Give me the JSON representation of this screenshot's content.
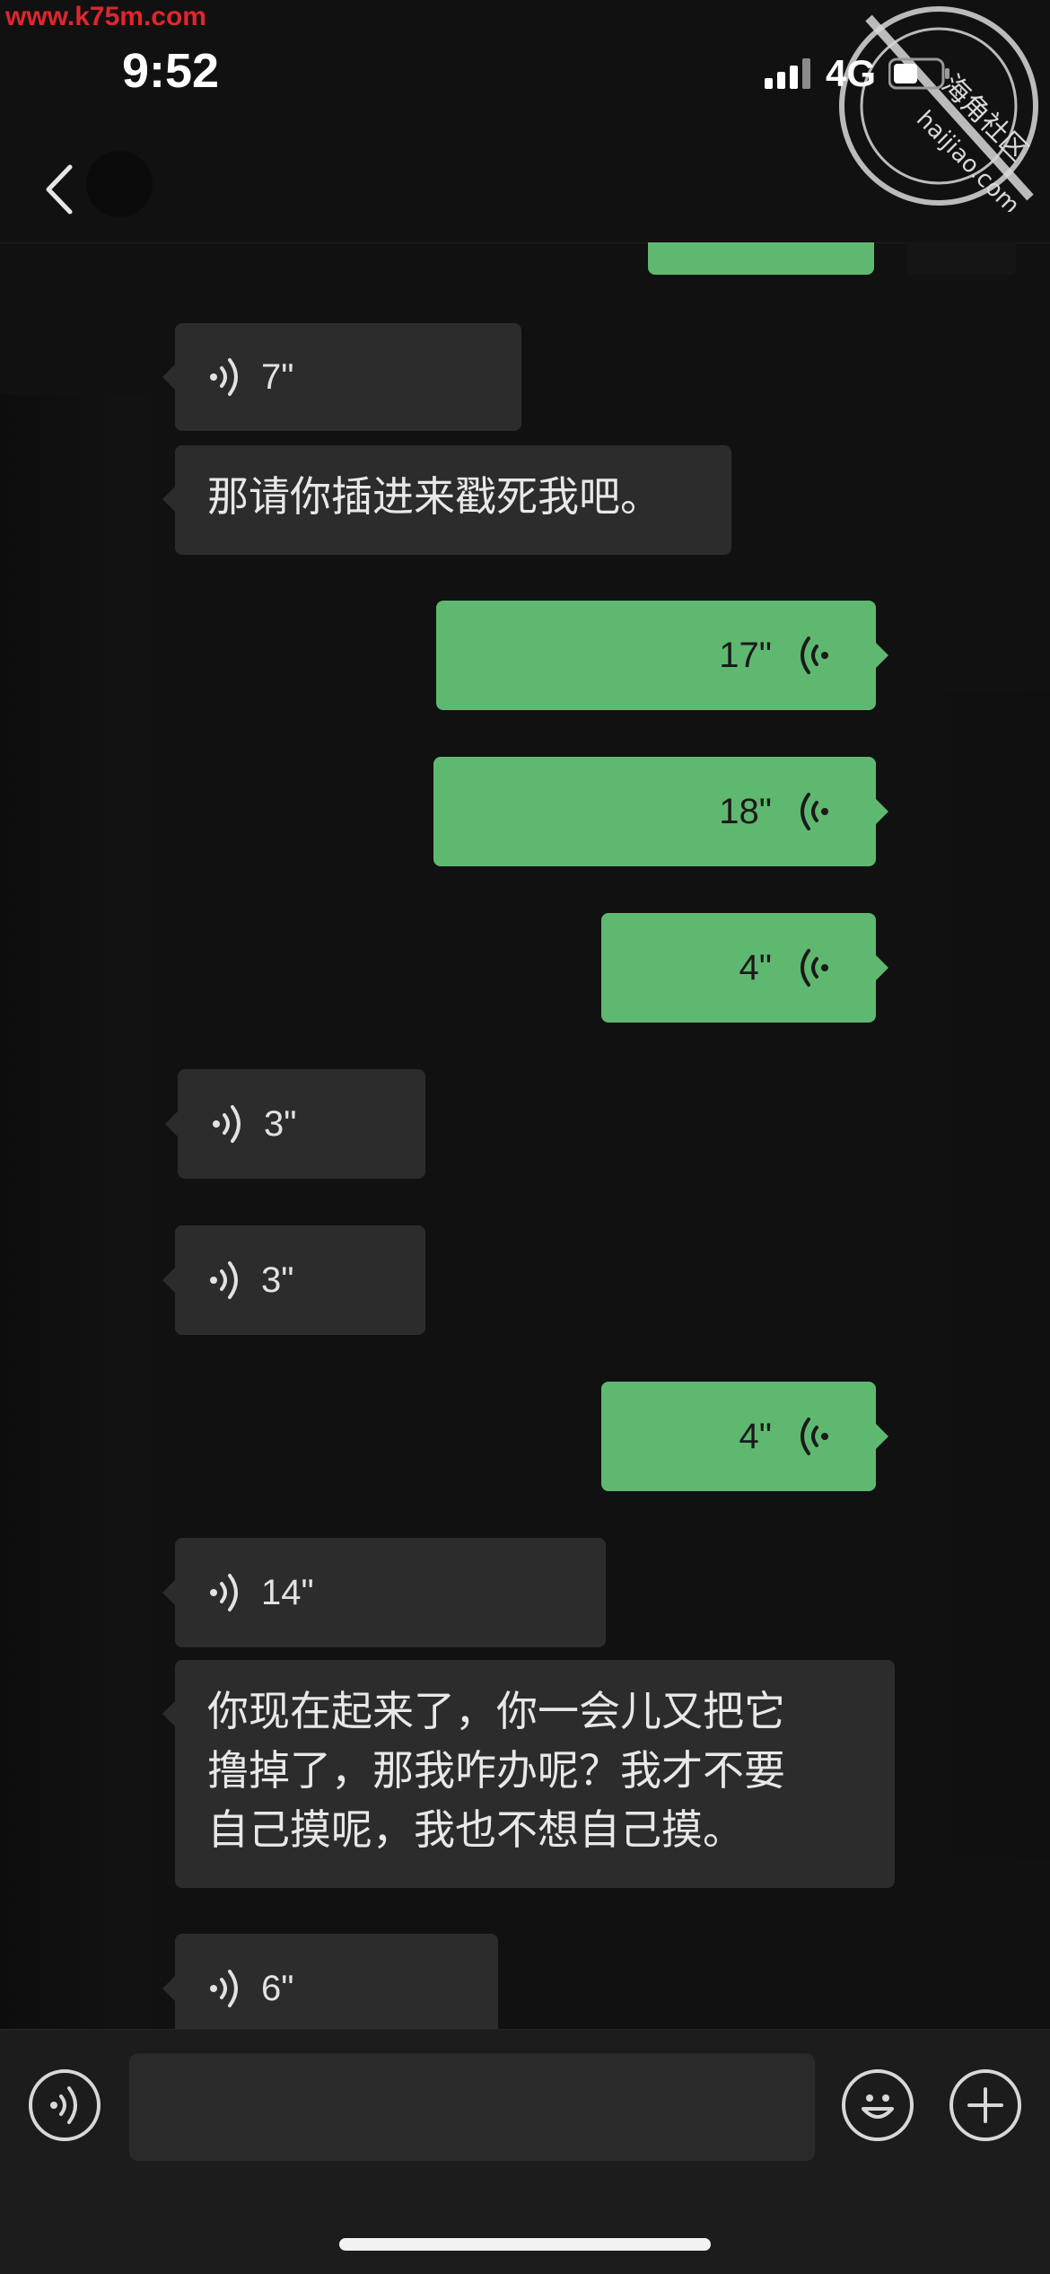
{
  "watermark": {
    "site": "www.k75m.com",
    "stamp_text": "海角社区",
    "stamp_url": "haijiao.com"
  },
  "status": {
    "time": "9:52",
    "network": "4G"
  },
  "nav": {
    "title": ""
  },
  "messages": [
    {
      "kind": "voice",
      "side": "in",
      "duration": "7\""
    },
    {
      "kind": "text",
      "side": "in",
      "text": "那请你插进来戳死我吧。"
    },
    {
      "kind": "voice",
      "side": "out",
      "duration": "17\""
    },
    {
      "kind": "voice",
      "side": "out",
      "duration": "18\""
    },
    {
      "kind": "voice",
      "side": "out",
      "duration": "4\""
    },
    {
      "kind": "voice",
      "side": "in",
      "duration": "3\""
    },
    {
      "kind": "voice",
      "side": "in",
      "duration": "3\""
    },
    {
      "kind": "voice",
      "side": "out",
      "duration": "4\""
    },
    {
      "kind": "voice",
      "side": "in",
      "duration": "14\""
    },
    {
      "kind": "text",
      "side": "in",
      "lines": [
        "你现在起来了，你一会儿又把它",
        "撸掉了，那我咋办呢？我才不要",
        "自己摸呢，我也不想自己摸。"
      ]
    },
    {
      "kind": "voice",
      "side": "in",
      "duration": "6\""
    }
  ],
  "composer": {
    "input_value": "",
    "voice_icon": "voice-mode-icon",
    "emoji_icon": "emoji-icon",
    "plus_icon": "plus-icon"
  },
  "colors": {
    "outgoing": "#5fb870",
    "incoming": "#2c2c2c",
    "background": "#111111"
  }
}
